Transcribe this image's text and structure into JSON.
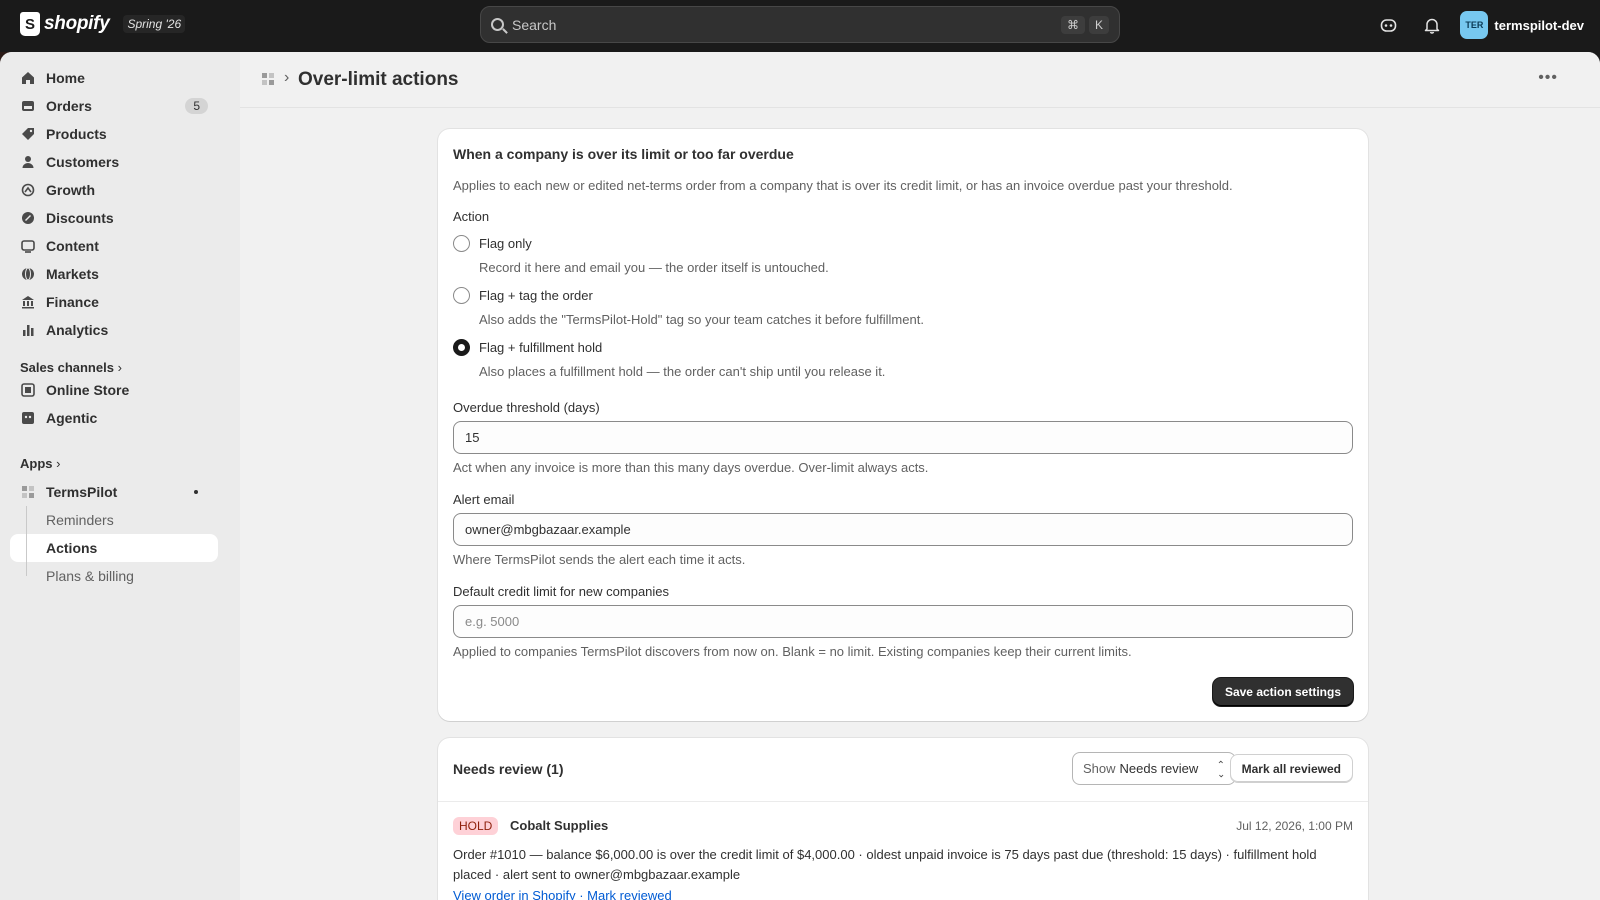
{
  "topbar": {
    "logo_text": "shopify",
    "edition": "Spring '26",
    "search_placeholder": "Search",
    "shortcut_cmd": "⌘",
    "shortcut_key": "K",
    "avatar_initials": "TER",
    "store_name": "termspilot-dev"
  },
  "sidebar": {
    "items": [
      {
        "label": "Home",
        "icon": "home-icon"
      },
      {
        "label": "Orders",
        "icon": "orders-icon",
        "badge": "5"
      },
      {
        "label": "Products",
        "icon": "tag-icon"
      },
      {
        "label": "Customers",
        "icon": "person-icon"
      },
      {
        "label": "Growth",
        "icon": "growth-icon"
      },
      {
        "label": "Discounts",
        "icon": "discount-icon"
      },
      {
        "label": "Content",
        "icon": "content-icon"
      },
      {
        "label": "Markets",
        "icon": "globe-icon"
      },
      {
        "label": "Finance",
        "icon": "bank-icon"
      },
      {
        "label": "Analytics",
        "icon": "chart-icon"
      }
    ],
    "sales_channels_label": "Sales channels",
    "channels": [
      {
        "label": "Online Store",
        "icon": "store-icon"
      },
      {
        "label": "Agentic",
        "icon": "agent-icon"
      }
    ],
    "apps_label": "Apps",
    "app": {
      "label": "TermsPilot",
      "sub_items": [
        "Reminders",
        "Actions",
        "Plans & billing"
      ]
    }
  },
  "page": {
    "title": "Over-limit actions"
  },
  "settings_card": {
    "title": "When a company is over its limit or too far overdue",
    "description": "Applies to each new or edited net-terms order from a company that is over its credit limit, or has an invoice overdue past your threshold.",
    "action_label": "Action",
    "options": [
      {
        "label": "Flag only",
        "help": "Record it here and email you — the order itself is untouched.",
        "checked": false
      },
      {
        "label": "Flag + tag the order",
        "help": "Also adds the \"TermsPilot-Hold\" tag so your team catches it before fulfillment.",
        "checked": false
      },
      {
        "label": "Flag + fulfillment hold",
        "help": "Also places a fulfillment hold — the order can't ship until you release it.",
        "checked": true
      }
    ],
    "threshold_label": "Overdue threshold (days)",
    "threshold_value": "15",
    "threshold_help": "Act when any invoice is more than this many days overdue. Over-limit always acts.",
    "email_label": "Alert email",
    "email_value": "owner@mbgbazaar.example",
    "email_help": "Where TermsPilot sends the alert each time it acts.",
    "limit_label": "Default credit limit for new companies",
    "limit_placeholder": "e.g. 5000",
    "limit_help": "Applied to companies TermsPilot discovers from now on. Blank = no limit. Existing companies keep their current limits.",
    "save_label": "Save action settings"
  },
  "review_card": {
    "title": "Needs review (1)",
    "show_prefix": "Show",
    "show_value": "Needs review",
    "mark_all_label": "Mark all reviewed",
    "events": [
      {
        "badge": "HOLD",
        "company": "Cobalt Supplies",
        "time": "Jul 12, 2026, 1:00 PM",
        "description": "Order #1010 — balance $6,000.00 is over the credit limit of $4,000.00 · oldest unpaid invoice is 75 days past due (threshold: 15 days) · fulfillment hold placed · alert sent to owner@mbgbazaar.example",
        "link": "View order in Shopify · Mark reviewed"
      }
    ]
  },
  "colors": {
    "topbar": "#1a1a1a",
    "primary_button": "#303030",
    "hold_badge_bg": "#fed1d7",
    "link": "#005bd3"
  }
}
